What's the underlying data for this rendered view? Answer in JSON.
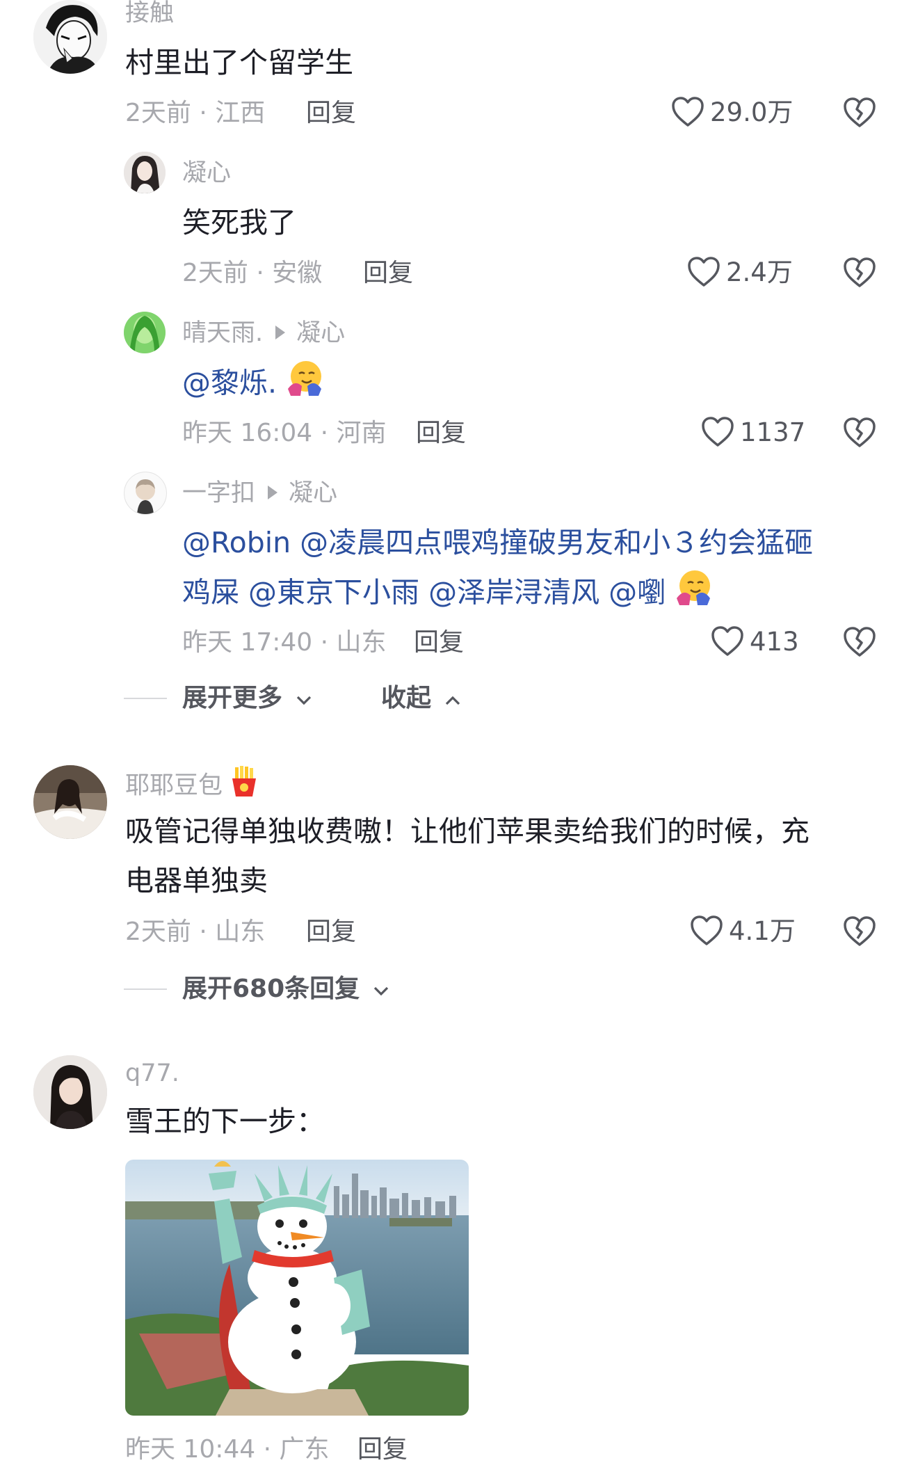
{
  "comments": [
    {
      "user": "接触",
      "text": "村里出了个留学生",
      "meta": "2天前 · 江西",
      "reply_label": "回复",
      "likes": "29.0万"
    },
    {
      "user": "凝心",
      "text": "笑死我了",
      "meta": "2天前 · 安徽",
      "reply_label": "回复",
      "likes": "2.4万"
    },
    {
      "user": "晴天雨.",
      "reply_to": "凝心",
      "text": "@黎烁.",
      "meta": "昨天 16:04 · 河南",
      "reply_label": "回复",
      "likes": "1137"
    },
    {
      "user": "一字扣",
      "reply_to": "凝心",
      "text_line1": "@Robin @凌晨四点喂鸡撞破男友和小３约会猛砸",
      "text_line2": "鸡屎 @東京下小雨 @泽岸浔清风 @嚠",
      "meta": "昨天 17:40 · 山东",
      "reply_label": "回复",
      "likes": "413"
    },
    {
      "user": "耶耶豆包",
      "text_line1": "吸管记得单独收费嗷！让他们苹果卖给我们的时候，充",
      "text_line2": "电器单独卖",
      "meta": "2天前 · 山东",
      "reply_label": "回复",
      "likes": "4.1万"
    },
    {
      "user": "q77.",
      "text": "雪王的下一步：",
      "meta": "昨天 10:44 · 广东",
      "reply_label": "回复"
    }
  ],
  "thread_controls": {
    "expand_more": "展开更多",
    "collapse": "收起",
    "expand_replies": "展开680条回复"
  },
  "icons": {
    "like": "heart-outline-icon",
    "dislike": "broken-heart-icon",
    "expand": "chevron-down-icon",
    "collapse": "chevron-up-icon"
  },
  "colors": {
    "mention": "#2b4f9e",
    "secondary_text": "#a7a8ad",
    "primary_text": "#1d1e26"
  }
}
